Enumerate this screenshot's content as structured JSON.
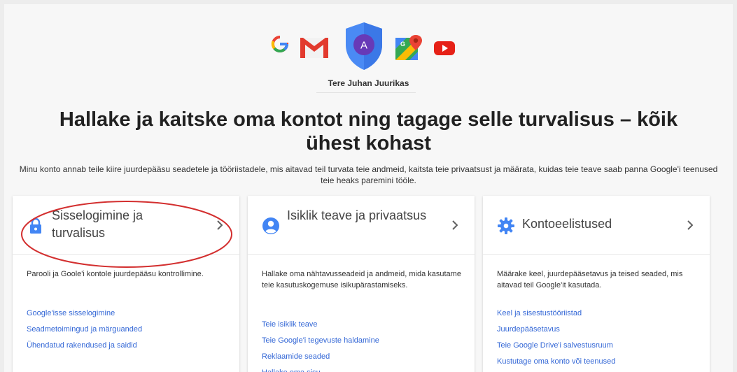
{
  "header": {
    "greeting": "Tere Juhan Juurikas",
    "avatar_letter": "A"
  },
  "headline": "Hallake ja kaitske oma kontot ning tagage selle turvalisus – kõik ühest kohast",
  "intro": "Minu konto annab teile kiire juurdepääsu seadetele ja tööriistadele, mis aitavad teil turvata teie andmeid, kaitsta teie privaatsust ja määrata, kuidas teie teave saab panna Google'i teenused teie heaks paremini tööle.",
  "cards": [
    {
      "icon": "lock-icon",
      "title": "Sisselogimine ja turvalisus",
      "description": "Parooli ja Goole'i kontole juurdepääsu kontrollimine.",
      "links": [
        "Google'isse sisselogimine",
        "Seadmetoimingud ja märguanded",
        "Ühendatud rakendused ja saidid"
      ]
    },
    {
      "icon": "person-icon",
      "title": "Isiklik teave ja privaatsus",
      "description": "Hallake oma nähtavusseadeid ja andmeid, mida kasutame teie kasutuskogemuse isikupärastamiseks.",
      "links": [
        "Teie isiklik teave",
        "Teie Google'i tegevuste haldamine",
        "Reklaamide seaded",
        "Hallake oma sisu"
      ]
    },
    {
      "icon": "gear-icon",
      "title": "Kontoeelistused",
      "description": "Määrake keel, juurdepääsetavus ja teised seaded, mis aitavad teil Google'it kasutada.",
      "links": [
        "Keel ja sisestustööriistad",
        "Juurdepääsetavus",
        "Teie Google Drive'i salvestusruum",
        "Kustutage oma konto või teenused"
      ]
    }
  ],
  "colors": {
    "link": "#3367d6",
    "shield": "#4a8af4",
    "avatar": "#673ab7",
    "annotation": "#d32f2f"
  }
}
